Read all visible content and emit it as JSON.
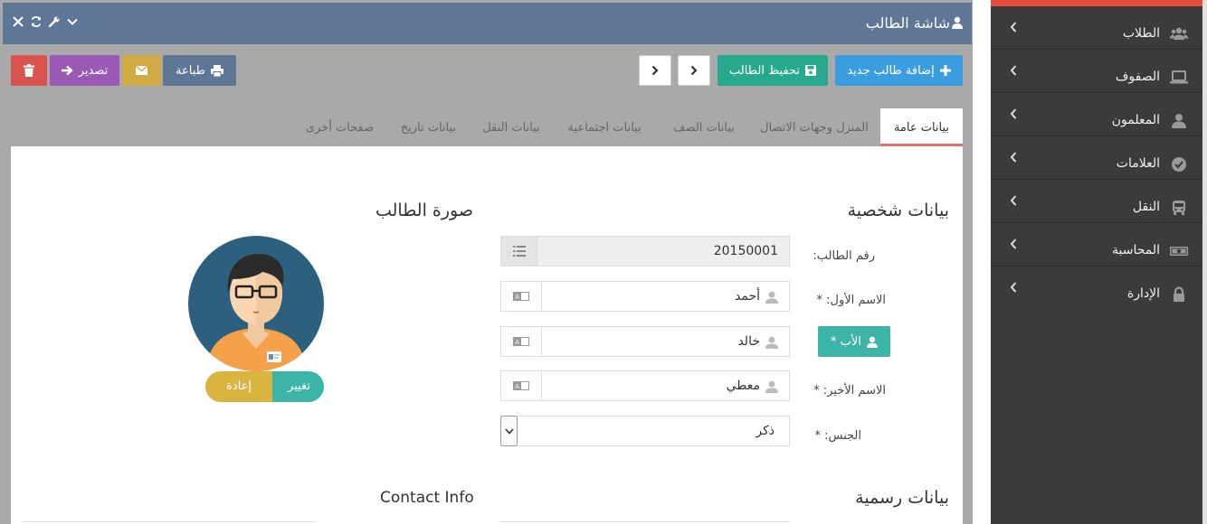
{
  "window": {
    "title": "شاشة الطالب"
  },
  "toolbar": {
    "add_new": "إضافة طالب جديد",
    "save": "تحفيظ الطالب",
    "print": "طباعة",
    "export": "تصدير"
  },
  "tabs": [
    {
      "label": "بيانات عامة",
      "active": true
    },
    {
      "label": "المنزل وجهات الاتصال"
    },
    {
      "label": "بيانات الصف"
    },
    {
      "label": "بيانات اجتماعية"
    },
    {
      "label": "بيانات النقل"
    },
    {
      "label": "بيانات تاريخ"
    },
    {
      "label": "صفحات أخرى"
    }
  ],
  "personal": {
    "heading": "بيانات شخصية",
    "student_id_label": "رقم الطالب:",
    "student_id": "20150001",
    "first_name_label": "الاسم الأول: *",
    "first_name": "أحمد",
    "father_label": "الأب *",
    "father": "خالد",
    "last_name_label": "الاسم الأخير: *",
    "last_name": "معطي",
    "gender_label": "الجنس: *",
    "gender": "ذكر"
  },
  "photo": {
    "heading": "صورة الطالب",
    "change": "تغيير",
    "reset": "إعادة"
  },
  "official": {
    "heading": "بيانات رسمية"
  },
  "contact": {
    "heading": "Contact Info"
  },
  "sidebar": {
    "items": [
      {
        "label": "الطلاب",
        "icon": "users-icon"
      },
      {
        "label": "الصفوف",
        "icon": "laptop-icon"
      },
      {
        "label": "المعلمون",
        "icon": "user-icon"
      },
      {
        "label": "العلامات",
        "icon": "check-circle-icon"
      },
      {
        "label": "النقل",
        "icon": "bus-icon"
      },
      {
        "label": "المحاسبة",
        "icon": "money-icon"
      },
      {
        "label": "الإدارة",
        "icon": "lock-icon"
      }
    ]
  },
  "colors": {
    "titlebar": "#5f7797",
    "add_button": "#3a9de0",
    "save_button": "#27a98d",
    "print_button": "#5f7797",
    "email_button": "#d1aa43",
    "export_button": "#9b59b6",
    "delete_button": "#d9534f",
    "father_button": "#3cb5a8",
    "sidebar_bg": "#3b3b3b",
    "sidebar_accent": "#e74c3c",
    "tab_active_underline": "#e07070"
  }
}
